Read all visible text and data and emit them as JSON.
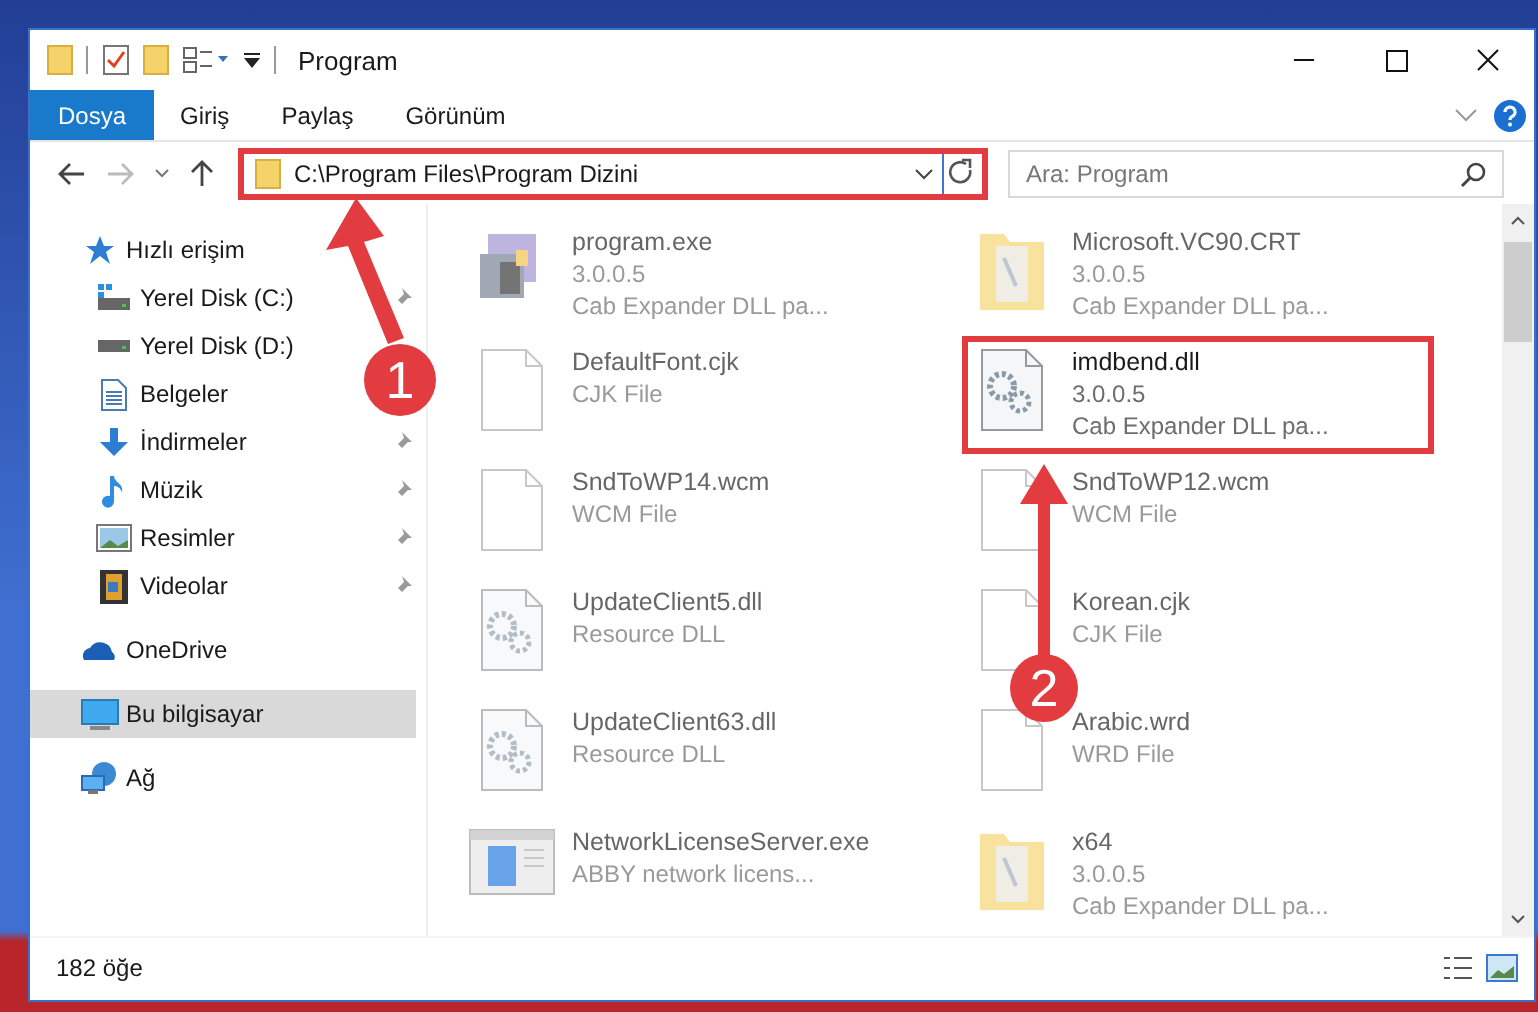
{
  "window": {
    "title": "Program"
  },
  "ribbon_tabs": [
    {
      "label": "Dosya",
      "selected": true
    },
    {
      "label": "Giriş",
      "selected": false
    },
    {
      "label": "Paylaş",
      "selected": false
    },
    {
      "label": "Görünüm",
      "selected": false
    }
  ],
  "address_bar": {
    "path": "C:\\Program Files\\Program Dizini",
    "highlighted": true
  },
  "search": {
    "placeholder": "Ara: Program"
  },
  "sidebar": {
    "items": [
      {
        "label": "Hızlı erişim",
        "kind": "star",
        "selected": false,
        "children": [
          {
            "label": "Yerel Disk (C:)",
            "kind": "drive-c",
            "pinned": true,
            "selected": false
          },
          {
            "label": "Yerel Disk (D:)",
            "kind": "drive",
            "selected": false
          },
          {
            "label": "Belgeler",
            "kind": "documents",
            "selected": false
          },
          {
            "label": "İndirmeler",
            "kind": "downloads",
            "pinned": true,
            "selected": false
          },
          {
            "label": "Müzik",
            "kind": "music",
            "pinned": true,
            "selected": false
          },
          {
            "label": "Resimler",
            "kind": "pictures",
            "pinned": true,
            "selected": false
          },
          {
            "label": "Videolar",
            "kind": "videos",
            "pinned": true,
            "selected": false
          }
        ]
      },
      {
        "label": "OneDrive",
        "kind": "cloud",
        "selected": false
      },
      {
        "label": "Bu bilgisayar",
        "kind": "computer",
        "selected": true
      },
      {
        "label": "Ağ",
        "kind": "network",
        "selected": false
      }
    ]
  },
  "files": [
    {
      "name": "program.exe",
      "details": [
        "3.0.0.5",
        "Cab Expander DLL pa..."
      ],
      "kind": "exe",
      "highlighted": false
    },
    {
      "name": "Microsoft.VC90.CRT",
      "details": [
        "3.0.0.5",
        "Cab Expander DLL pa..."
      ],
      "kind": "folder",
      "highlighted": false
    },
    {
      "name": "DefaultFont.cjk",
      "details": [
        "CJK File"
      ],
      "kind": "file",
      "highlighted": false
    },
    {
      "name": "imdbend.dll",
      "details": [
        "3.0.0.5",
        "Cab Expander DLL pa..."
      ],
      "kind": "dll",
      "highlighted": true
    },
    {
      "name": "SndToWP14.wcm",
      "details": [
        "WCM File"
      ],
      "kind": "file",
      "highlighted": false
    },
    {
      "name": "SndToWP12.wcm",
      "details": [
        "WCM File"
      ],
      "kind": "file",
      "highlighted": false
    },
    {
      "name": "UpdateClient5.dll",
      "details": [
        "Resource DLL"
      ],
      "kind": "dll",
      "highlighted": false
    },
    {
      "name": "Korean.cjk",
      "details": [
        "CJK File"
      ],
      "kind": "file",
      "highlighted": false
    },
    {
      "name": "UpdateClient63.dll",
      "details": [
        "Resource DLL"
      ],
      "kind": "dll",
      "highlighted": false
    },
    {
      "name": "Arabic.wrd",
      "details": [
        "WRD File"
      ],
      "kind": "file",
      "highlighted": false
    },
    {
      "name": "NetworkLicenseServer.exe",
      "details": [
        "ABBY network licens..."
      ],
      "kind": "app",
      "highlighted": false
    },
    {
      "name": "x64",
      "details": [
        "3.0.0.5",
        "Cab Expander DLL pa..."
      ],
      "kind": "folder",
      "highlighted": false
    }
  ],
  "annotations": [
    {
      "number": "1"
    },
    {
      "number": "2"
    }
  ],
  "status_bar": {
    "item_count": "182 öğe"
  }
}
